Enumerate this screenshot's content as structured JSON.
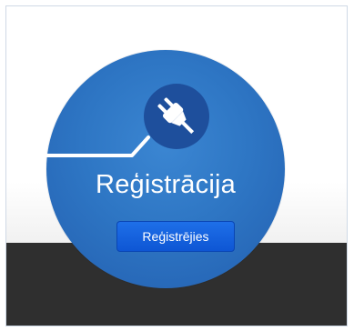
{
  "title": "Reģistrācija",
  "button_label": "Reģistrējies",
  "icons": {
    "plug": "power-plug-icon"
  },
  "colors": {
    "circle": "#2e76c4",
    "button": "#1e6fe8",
    "dark_band": "#2f2f2f",
    "plug_badge": "#1e4f9c"
  }
}
